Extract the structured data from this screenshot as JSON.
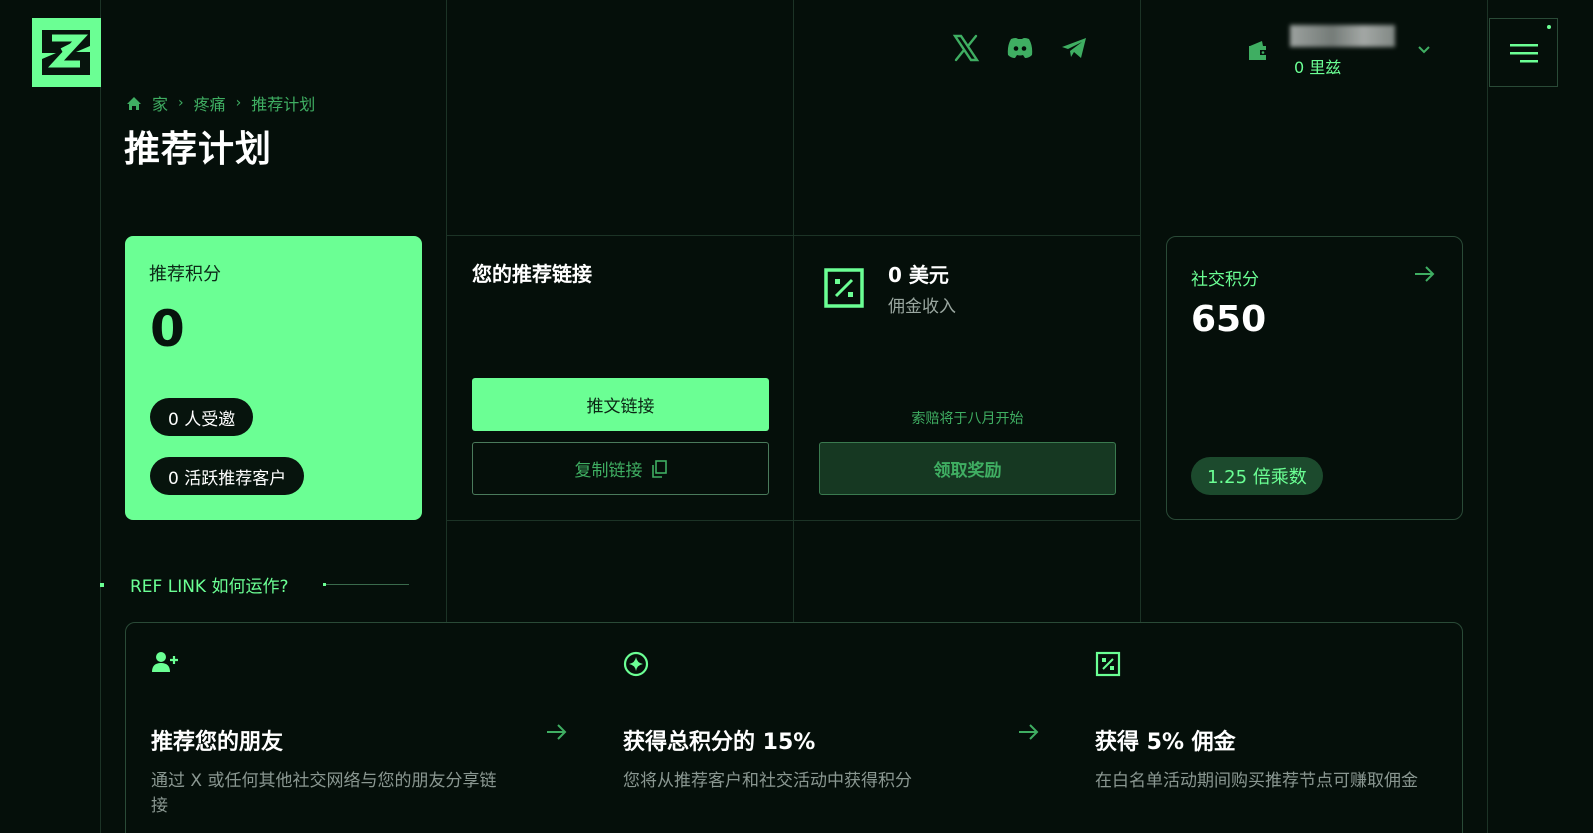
{
  "header": {
    "wallet_balance": "0 里兹",
    "social_links": [
      "x-icon",
      "discord-icon",
      "telegram-icon"
    ]
  },
  "breadcrumb": [
    "家",
    "疼痛",
    "推荐计划"
  ],
  "page_title": "推荐计划",
  "referral_card": {
    "label": "推荐积分",
    "value": "0",
    "invited": "0 人受邀",
    "active": "0 活跃推荐客户"
  },
  "link_card": {
    "title": "您的推荐链接",
    "tweet_button": "推文链接",
    "copy_button": "复制链接"
  },
  "commission_card": {
    "amount": "0 美元",
    "label": "佣金收入",
    "note": "索赔将于八月开始",
    "claim_button": "领取奖励"
  },
  "social_card": {
    "label": "社交积分",
    "value": "650",
    "multiplier": "1.25 倍乘数"
  },
  "howto": {
    "label": "REF LINK 如何运作?"
  },
  "steps": [
    {
      "icon": "user-plus-icon",
      "title": "推荐您的朋友",
      "desc": "通过 X 或任何其他社交网络与您的朋友分享链接"
    },
    {
      "icon": "sparkle-icon",
      "title": "获得总积分的 15%",
      "desc": "您将从推荐客户和社交活动中获得积分"
    },
    {
      "icon": "percent-icon",
      "title": "获得 5% 佣金",
      "desc": "在白名单活动期间购买推荐节点可赚取佣金"
    }
  ],
  "colors": {
    "accent": "#6bff94",
    "background": "#050f0a",
    "muted_green": "#3fae62"
  }
}
